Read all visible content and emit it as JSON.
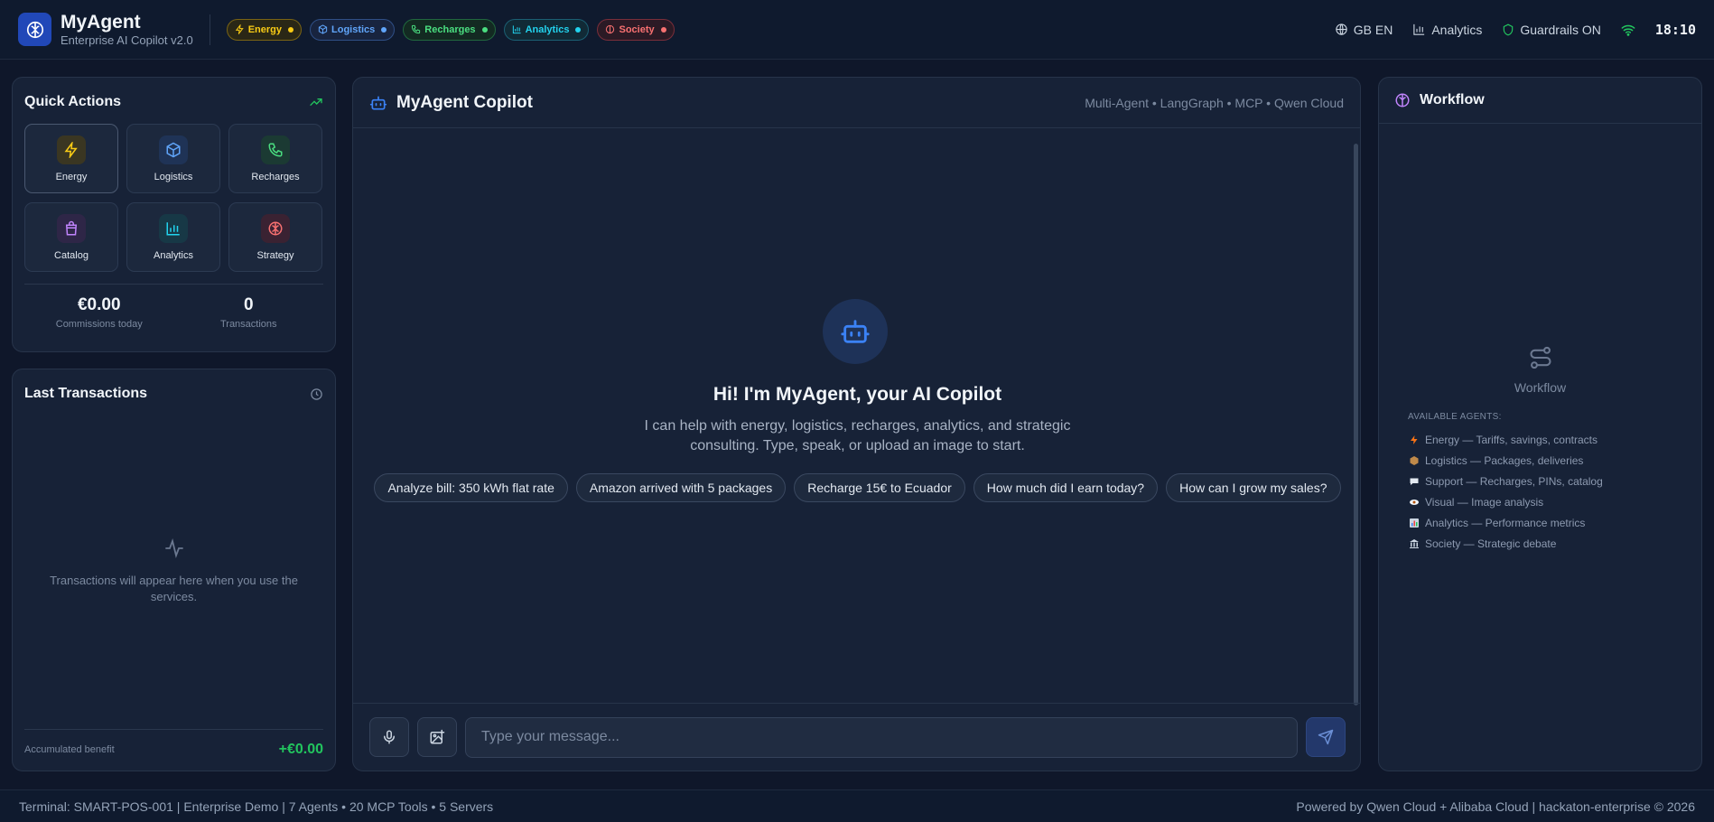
{
  "header": {
    "brand_title": "MyAgent",
    "brand_subtitle": "Enterprise AI Copilot v2.0",
    "chips": [
      {
        "label": "Energy",
        "color": "#facc15"
      },
      {
        "label": "Logistics",
        "color": "#60a5fa"
      },
      {
        "label": "Recharges",
        "color": "#4ade80"
      },
      {
        "label": "Analytics",
        "color": "#22d3ee"
      },
      {
        "label": "Society",
        "color": "#f87171"
      }
    ],
    "language": "GB EN",
    "analytics_label": "Analytics",
    "guardrails_label": "Guardrails ON",
    "clock": "18:10"
  },
  "quick_actions": {
    "title": "Quick Actions",
    "tiles": [
      {
        "label": "Energy",
        "icon": "bolt-icon",
        "color": "#facc15"
      },
      {
        "label": "Logistics",
        "icon": "box-icon",
        "color": "#60a5fa"
      },
      {
        "label": "Recharges",
        "icon": "phone-icon",
        "color": "#4ade80"
      },
      {
        "label": "Catalog",
        "icon": "bag-icon",
        "color": "#c084fc"
      },
      {
        "label": "Analytics",
        "icon": "bar-chart-icon",
        "color": "#22d3ee"
      },
      {
        "label": "Strategy",
        "icon": "brain-icon",
        "color": "#f87171"
      }
    ],
    "commissions_value": "€0.00",
    "commissions_label": "Commissions today",
    "transactions_value": "0",
    "transactions_label": "Transactions"
  },
  "last_transactions": {
    "title": "Last Transactions",
    "empty_text": "Transactions will appear here when you use the services.",
    "benefit_label": "Accumulated benefit",
    "benefit_value": "+€0.00"
  },
  "chat": {
    "title": "MyAgent Copilot",
    "meta": "Multi-Agent • LangGraph • MCP • Qwen Cloud",
    "welcome_title": "Hi! I'm MyAgent, your AI Copilot",
    "welcome_text": "I can help with energy, logistics, recharges, analytics, and strategic consulting. Type, speak, or upload an image to start.",
    "suggestions": [
      "Analyze bill: 350 kWh flat rate",
      "Amazon arrived with 5 packages",
      "Recharge 15€ to Ecuador",
      "How much did I earn today?",
      "How can I grow my sales?"
    ],
    "input_placeholder": "Type your message..."
  },
  "workflow": {
    "title": "Workflow",
    "placeholder_label": "Workflow",
    "agents_title": "AVAILABLE AGENTS:",
    "agents": [
      {
        "label": "Energy — Tariffs, savings, contracts",
        "icon": "bolt-icon"
      },
      {
        "label": "Logistics — Packages, deliveries",
        "icon": "package-icon"
      },
      {
        "label": "Support — Recharges, PINs, catalog",
        "icon": "speech-bubble-icon"
      },
      {
        "label": "Visual — Image analysis",
        "icon": "eye-icon"
      },
      {
        "label": "Analytics — Performance metrics",
        "icon": "bar-chart-icon"
      },
      {
        "label": "Society — Strategic debate",
        "icon": "classical-building-icon"
      }
    ]
  },
  "footer": {
    "left": "Terminal: SMART-POS-001 | Enterprise Demo | 7 Agents • 20 MCP Tools • 5 Servers",
    "right": "Powered by Qwen Cloud + Alibaba Cloud | hackaton-enterprise © 2026"
  }
}
